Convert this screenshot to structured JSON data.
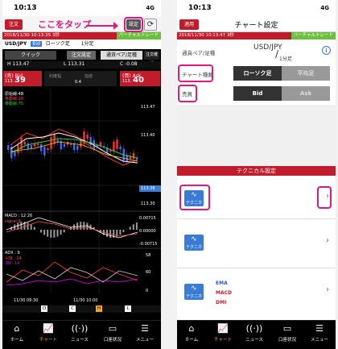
{
  "status": {
    "time": "10:13",
    "signal": "4G"
  },
  "left": {
    "order_label": "注文",
    "annotation": "ここをタップ",
    "settings_label": "設定",
    "info_bar": "2018/11/30 10:13:35  3秒",
    "virtual_label": "バーチャルトレード",
    "pair": "USD/JPY",
    "bid_tag": "Bid",
    "chart_kind": "ローソク足",
    "period": "1分足",
    "quick_label": "クイック",
    "order_setting_label": "注文設定",
    "pair_switch_label": "通貨ペア/足種",
    "order_confirm": "注文確認",
    "high": "H 113.47",
    "low": "L 113.31",
    "change": "C -0.08",
    "bid_label": "(売) Bid",
    "ask_label": "(買) Ask",
    "bid_small": "113.",
    "bid_big": "39",
    "ask_small": "113.",
    "ask_big": "40",
    "spread": "0.4",
    "sub_labels": [
      "利確幅",
      "指値",
      ""
    ],
    "ma_legend": [
      "原始線:4B",
      "移動線:20",
      "移動線:75"
    ],
    "y_ticks": [
      "113.47",
      "113.40",
      "113.38",
      "113.30"
    ],
    "macd_label": "MACD : 12 26",
    "macd_sub": "signal:9",
    "macd_ticks": [
      "0.00715",
      "0.00000",
      "-0.00715"
    ],
    "adx_label": "ADX : 9",
    "adx_sub": [
      "+DI : 14",
      "-DI : 14"
    ],
    "adx_ticks": [
      "58",
      "60",
      "0"
    ],
    "x_ticks": [
      "11/30 09:30",
      "11/30 10:00"
    ],
    "ohlc_buttons": [
      "O",
      "C",
      "H",
      "L"
    ],
    "tabs": [
      "ホーム",
      "チャート",
      "ニュース",
      "口座状況",
      "メニュー"
    ]
  },
  "right": {
    "apply_label": "適用",
    "title": "チャート設定",
    "info_bar": "2018/11/30 10:13:47  3秒",
    "virtual_label": "バーチャルトレード",
    "pair_label": "通貨ペア/足種",
    "pair_value": "USD/JPY",
    "period_value": "1分足",
    "chart_type_label": "チャート種類",
    "candle_label": "ローソク足",
    "avg_label": "平均足",
    "side_label": "売買",
    "bid_label": "Bid",
    "ask_label": "Ask",
    "tech_header": "テクニカル設定",
    "tech_rows": [
      {
        "icon_text": "テクニカル1",
        "items": []
      },
      {
        "icon_text": "テクニカル2",
        "items": []
      },
      {
        "icon_text": "テクニカル3",
        "items": [
          "EMA",
          "MACD",
          "DMI"
        ]
      }
    ],
    "tabs": [
      "ホーム",
      "チャート",
      "ニュース",
      "口座状況",
      "メニュー"
    ]
  },
  "colors": {
    "brand_red": "#c01c2c",
    "annotation": "#e0197d",
    "active_tab": "#f5a623",
    "virtual": "#6cbf3c"
  }
}
